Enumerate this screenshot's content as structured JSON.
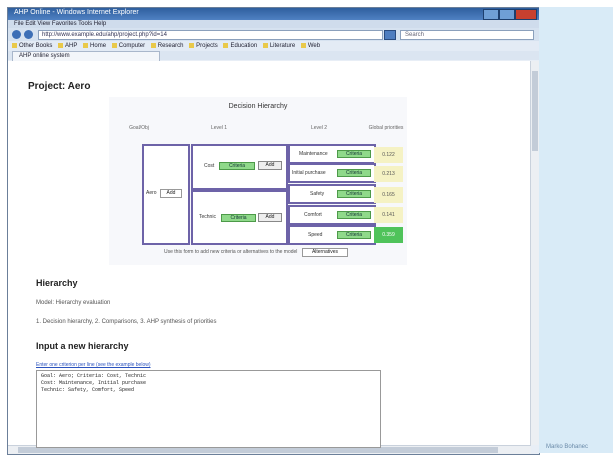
{
  "browser": {
    "title": "AHP Online - Windows Internet Explorer",
    "menu": "File   Edit   View   Favorites   Tools   Help",
    "url": "http://www.example.edu/ahp/project.php?id=14",
    "search_placeholder": "Search",
    "favorites": [
      "Other Books",
      "AHP",
      "Home",
      "Computer",
      "Research",
      "Projects",
      "Education",
      "Literature",
      "Web"
    ],
    "tab_label": "AHP online system"
  },
  "page": {
    "project_title": "Project: Aero",
    "hierarchy": {
      "title": "Decision Hierarchy",
      "col_headers": [
        "Goal/Obj",
        "Level 1",
        "Level 2",
        "Global priorities"
      ],
      "goal": {
        "label": "Aero",
        "button": "Add"
      },
      "level1": [
        {
          "label": "Cost",
          "button": "Add",
          "field": "Criteria"
        },
        {
          "label": "Technic",
          "button": "Add",
          "field": "Criteria"
        }
      ],
      "level2": [
        {
          "label": "Maintenance",
          "field": "Criteria",
          "priority": "0.122"
        },
        {
          "label": "Initial purchase",
          "field": "Criteria",
          "priority": "0.213"
        },
        {
          "label": "Safety",
          "field": "Criteria",
          "priority": "0.165"
        },
        {
          "label": "Comfort",
          "field": "Criteria",
          "priority": "0.141"
        },
        {
          "label": "Speed",
          "field": "Criteria",
          "priority": "0.359"
        }
      ],
      "footer_note": "Use this form to add new criteria or alternatives to the model",
      "footer_button": "Alternatives"
    },
    "hierarchy_section": {
      "heading": "Hierarchy",
      "line1": "Model: Hierarchy evaluation",
      "line2": "1. Decision hierarchy, 2. Comparisons, 3. AHP synthesis of priorities"
    },
    "input_section": {
      "heading": "Input a new hierarchy",
      "help_link": "Enter one criterion per line (see the example below)",
      "textarea_value": "Goal: Aero; Criteria: Cost, Technic\nCost: Maintenance, Initial purchase\nTechnic: Safety, Comfort, Speed"
    }
  },
  "slide": {
    "footer_name": "Marko Bohanec"
  }
}
